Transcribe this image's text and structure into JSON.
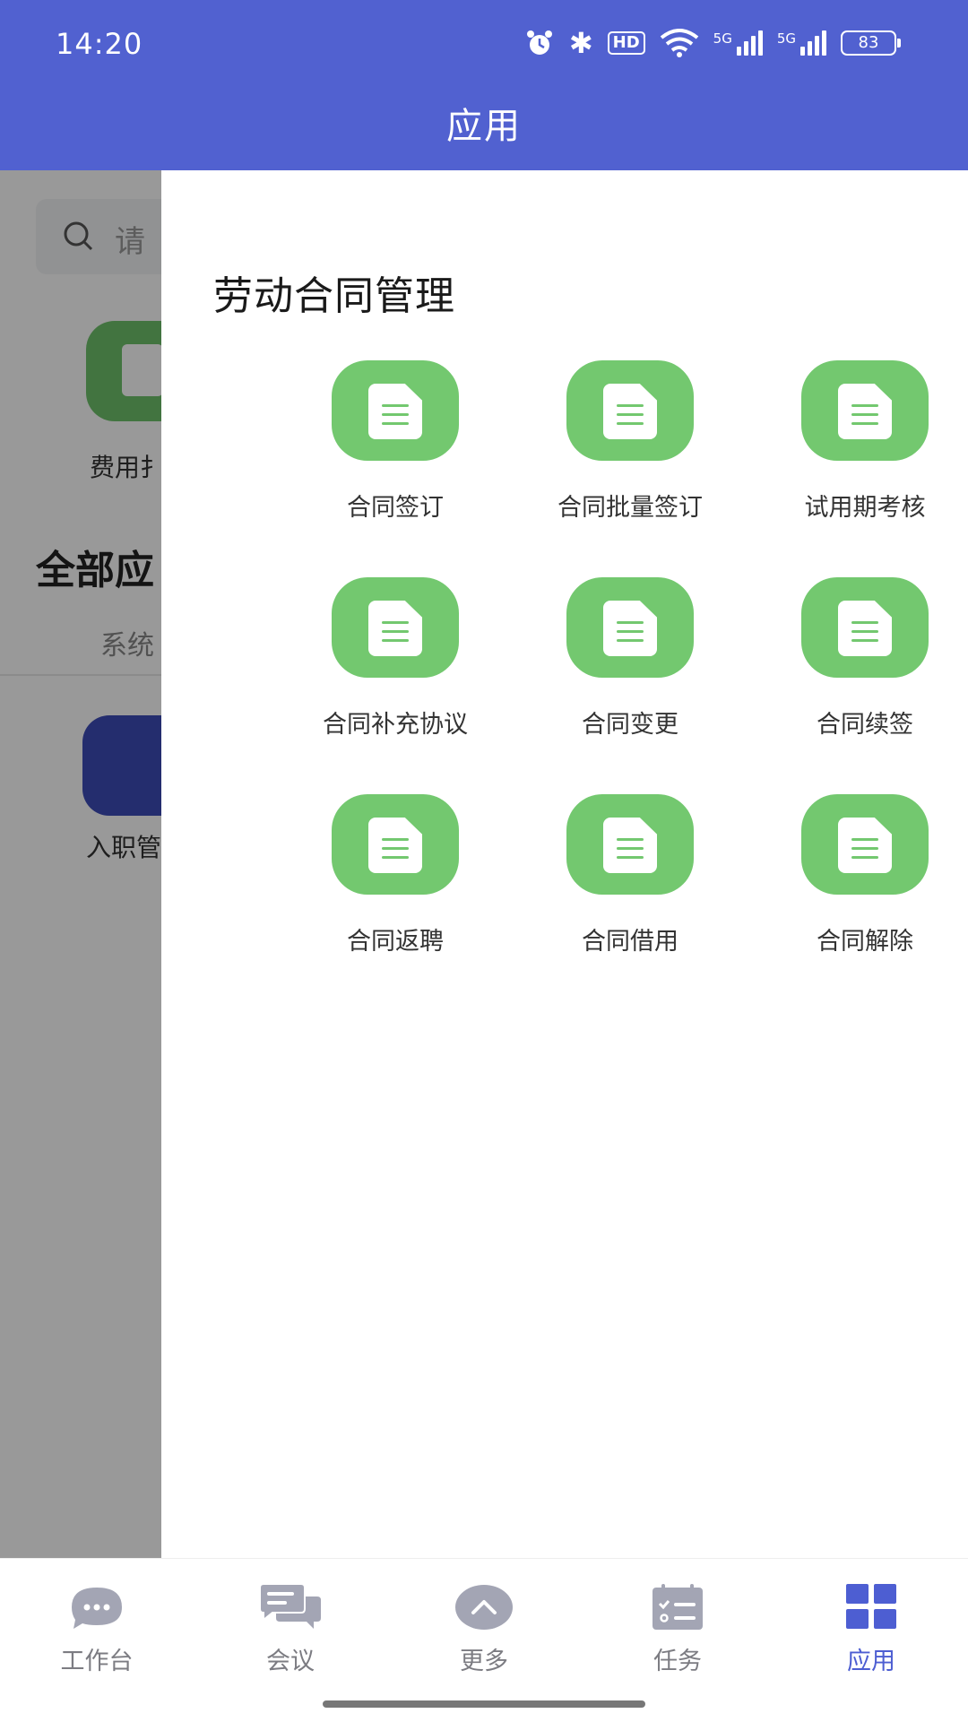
{
  "status_bar": {
    "time": "14:20",
    "hd_label": "HD",
    "signal1_label": "5G",
    "signal2_label": "5G",
    "battery": "83"
  },
  "header": {
    "title": "应用"
  },
  "background_page": {
    "search_placeholder": "请",
    "fav_label": "费用扌",
    "section_title": "全部应",
    "tab_label": "系统",
    "folder_label": "入职管"
  },
  "drawer": {
    "title": "劳动合同管理",
    "apps": [
      {
        "label": "合同签订"
      },
      {
        "label": "合同批量签订"
      },
      {
        "label": "试用期考核"
      },
      {
        "label": "合同补充协议"
      },
      {
        "label": "合同变更"
      },
      {
        "label": "合同续签"
      },
      {
        "label": "合同返聘"
      },
      {
        "label": "合同借用"
      },
      {
        "label": "合同解除"
      }
    ]
  },
  "bottom_nav": {
    "items": [
      {
        "label": "工作台",
        "icon": "chat-bubble-icon"
      },
      {
        "label": "会议",
        "icon": "meeting-icon"
      },
      {
        "label": "更多",
        "icon": "chevron-up-icon"
      },
      {
        "label": "任务",
        "icon": "task-checklist-icon"
      },
      {
        "label": "应用",
        "icon": "grid-apps-icon"
      }
    ],
    "active_index": 4
  },
  "colors": {
    "header": "#5161d0",
    "app_icon": "#73c86f",
    "nav_active": "#4d5ed2",
    "nav_inactive": "#a3a5b4"
  }
}
